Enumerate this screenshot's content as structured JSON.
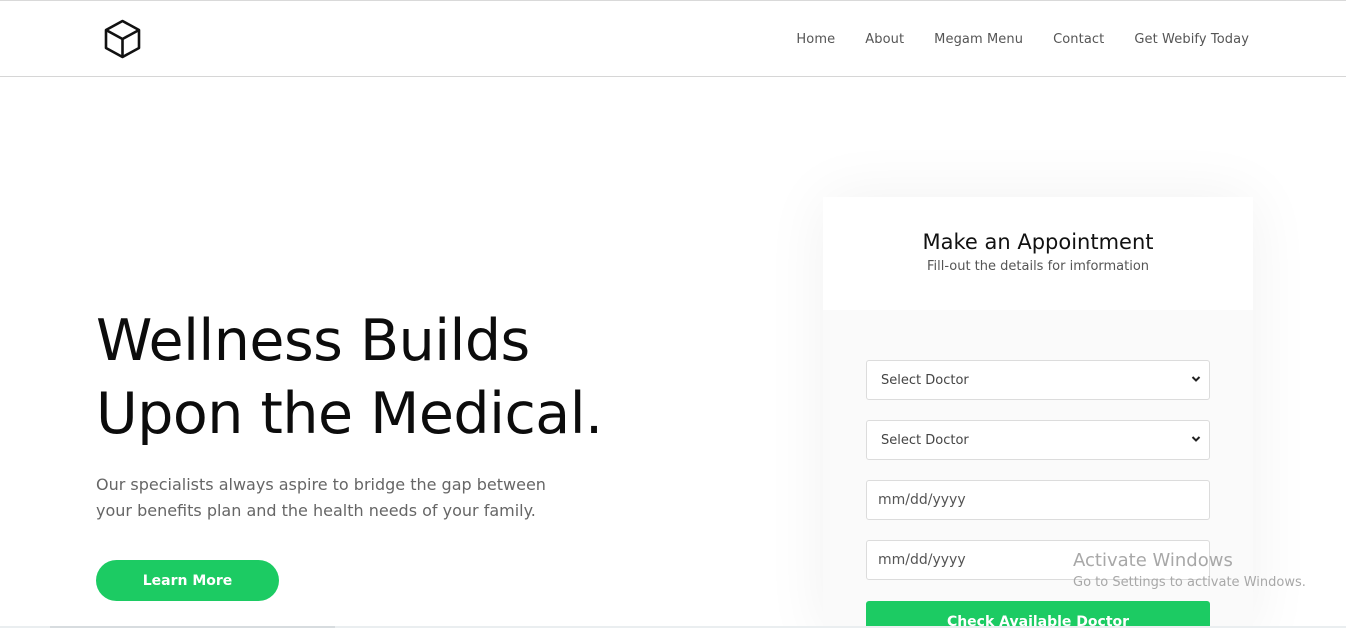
{
  "nav": {
    "items": [
      {
        "label": "Home"
      },
      {
        "label": "About"
      },
      {
        "label": "Megam Menu"
      },
      {
        "label": "Contact"
      },
      {
        "label": "Get Webify Today"
      }
    ]
  },
  "logo": {
    "icon": "cube-icon"
  },
  "hero": {
    "title_line1": "Wellness Builds",
    "title_line2": "Upon the Medical.",
    "subtitle_line1": "Our specialists always aspire to bridge the gap between",
    "subtitle_line2": "your benefits plan and the health needs of your family.",
    "cta_label": "Learn More"
  },
  "appointment": {
    "title": "Make an Appointment",
    "subtitle": "Fill-out the details for imformation",
    "select_1": "Select Doctor",
    "select_2": "Select Doctor",
    "date_1_placeholder": "mm/dd/yyyy",
    "date_2_placeholder": "mm/dd/yyyy",
    "submit_label": "Check Available Doctor"
  },
  "watermark": {
    "title": "Activate Windows",
    "subtitle": "Go to Settings to activate Windows."
  },
  "colors": {
    "accent": "#1ccb63",
    "text_dark": "#0c0c0c",
    "text_muted": "#666666"
  }
}
